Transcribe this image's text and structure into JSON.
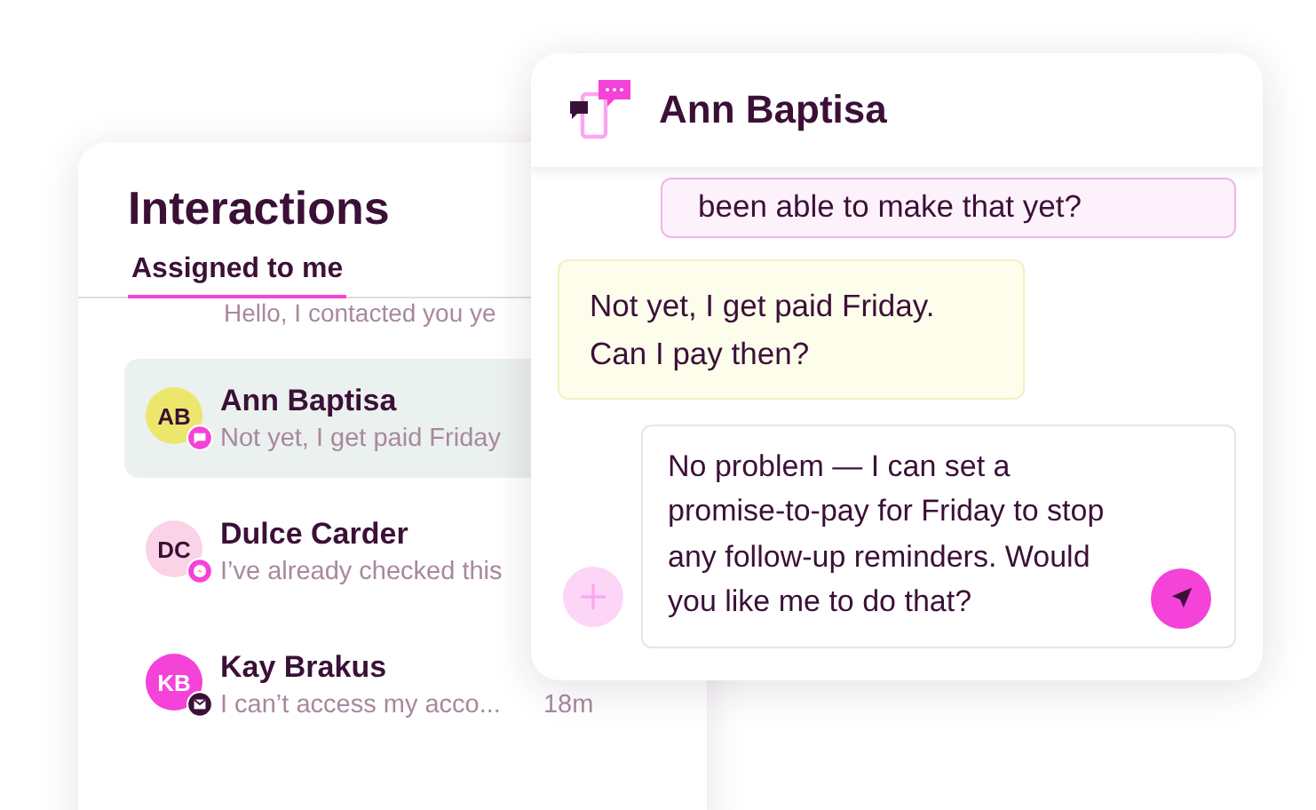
{
  "interactions": {
    "title": "Interactions",
    "tabs": [
      {
        "label": "Assigned to me",
        "selected": true
      }
    ],
    "partial_preview": "Hello, I contacted you ye",
    "items": [
      {
        "initials": "AB",
        "name": "Ann Baptisa",
        "preview": "Not yet, I get paid Friday",
        "color": "#ece76c",
        "kind": "chat",
        "selected": true
      },
      {
        "initials": "DC",
        "name": "Dulce Carder",
        "preview": "I’ve already checked this",
        "color": "#fbd3e6",
        "kind": "messenger",
        "selected": false
      },
      {
        "initials": "KB",
        "name": "Kay Brakus",
        "preview": "I can’t access my acco...",
        "time": "18m",
        "color": "#f542d8",
        "kind": "email",
        "selected": false
      }
    ]
  },
  "chat": {
    "title": "Ann Baptisa",
    "messages": [
      {
        "kind": "agent",
        "text": "been able to make that yet?"
      },
      {
        "kind": "customer",
        "text": "Not yet, I get paid Friday.\nCan I pay then?"
      }
    ],
    "composer": {
      "value": "No problem — I can set a promise-to-pay for Friday to stop any follow-up reminders. Would you like me to do that?"
    }
  }
}
